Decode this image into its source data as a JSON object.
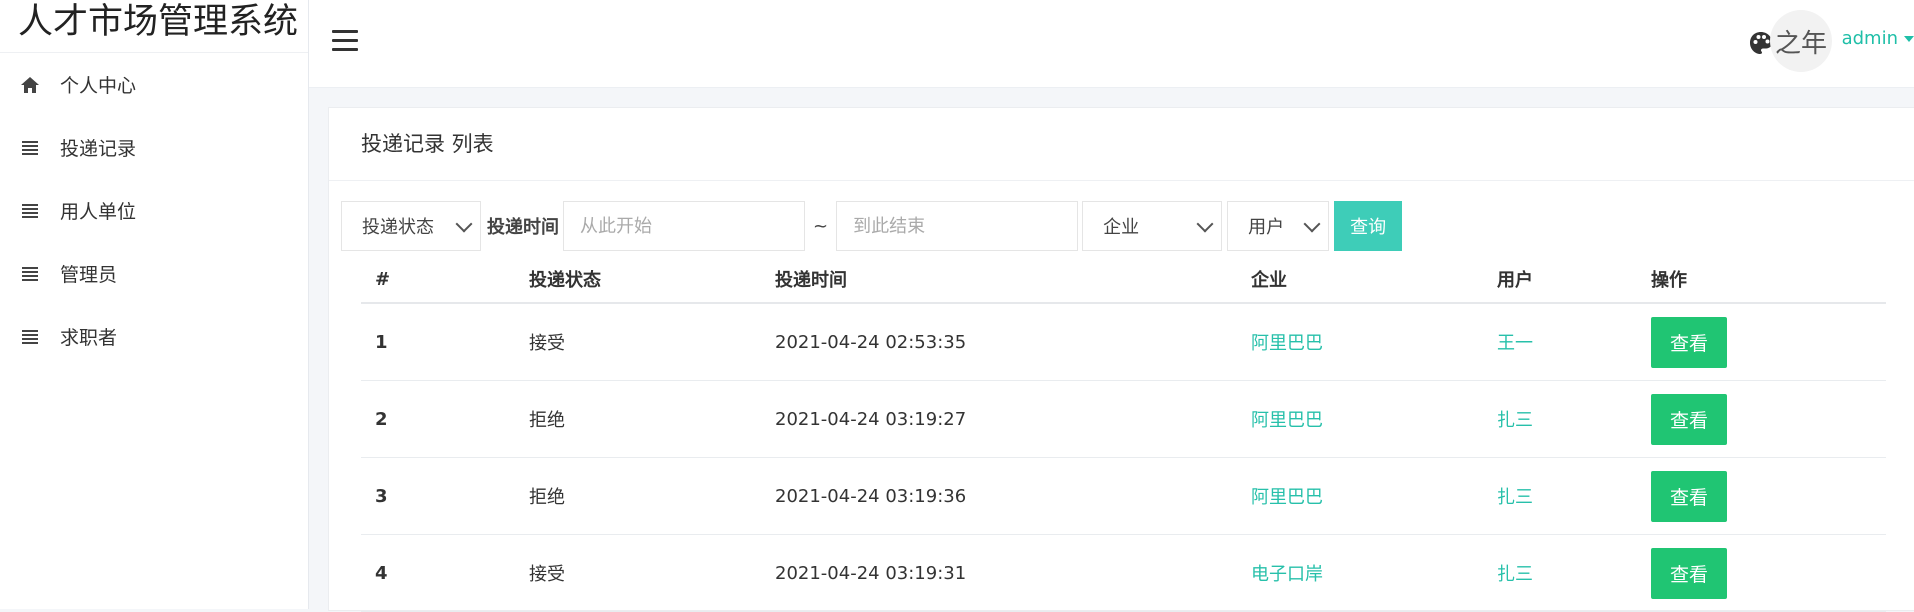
{
  "app": {
    "title": "人才市场管理系统"
  },
  "sidebar": {
    "items": [
      {
        "label": "个人中心",
        "icon": "home-icon"
      },
      {
        "label": "投递记录",
        "icon": "list-icon"
      },
      {
        "label": "用人单位",
        "icon": "list-icon"
      },
      {
        "label": "管理员",
        "icon": "list-icon"
      },
      {
        "label": "求职者",
        "icon": "list-icon"
      }
    ]
  },
  "header": {
    "avatar_text": "之年",
    "username": "admin"
  },
  "main": {
    "card_title": "投递记录 列表",
    "filters": {
      "status_select": "投递状态",
      "time_label": "投递时间",
      "start_placeholder": "从此开始",
      "separator": "~",
      "end_placeholder": "到此结束",
      "company_select": "企业",
      "user_select": "用户",
      "query_button": "查询"
    },
    "table": {
      "columns": [
        "#",
        "投递状态",
        "投递时间",
        "企业",
        "用户",
        "操作"
      ],
      "rows": [
        {
          "num": "1",
          "status": "接受",
          "time": "2021-04-24 02:53:35",
          "company": "阿里巴巴",
          "user": "王一",
          "action": "查看"
        },
        {
          "num": "2",
          "status": "拒绝",
          "time": "2021-04-24 03:19:27",
          "company": "阿里巴巴",
          "user": "扎三",
          "action": "查看"
        },
        {
          "num": "3",
          "status": "拒绝",
          "time": "2021-04-24 03:19:36",
          "company": "阿里巴巴",
          "user": "扎三",
          "action": "查看"
        },
        {
          "num": "4",
          "status": "接受",
          "time": "2021-04-24 03:19:31",
          "company": "电子口岸",
          "user": "扎三",
          "action": "查看"
        }
      ]
    }
  },
  "colors": {
    "accent": "#3ecdb8",
    "link": "#27c0aa",
    "view_button": "#20c573"
  }
}
